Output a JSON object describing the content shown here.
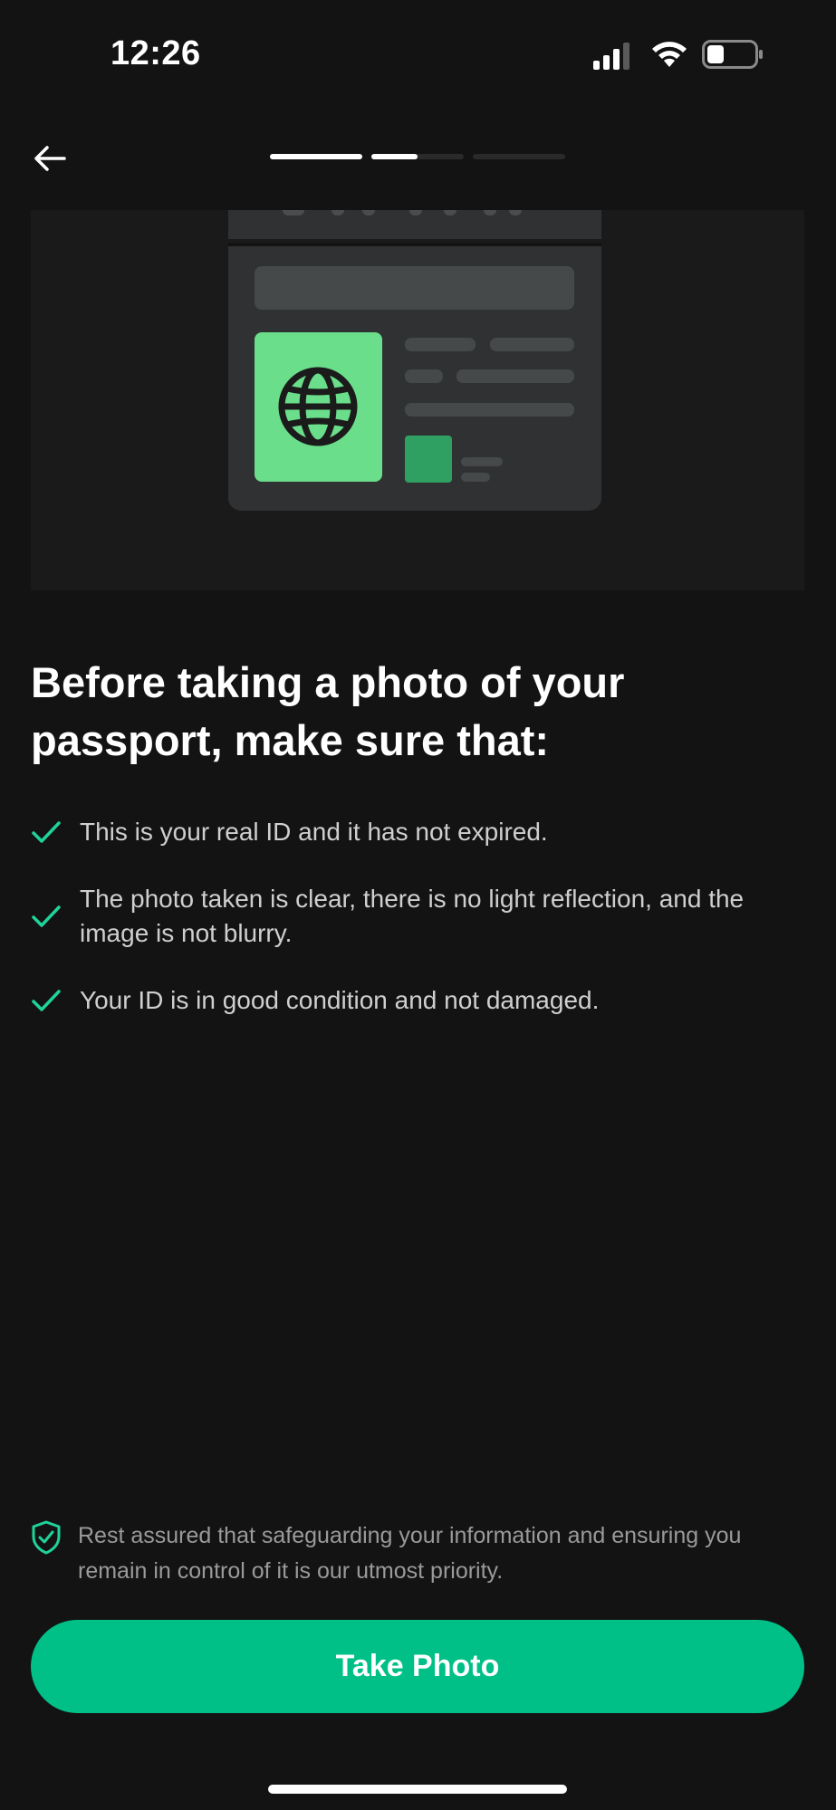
{
  "status_bar": {
    "time": "12:26",
    "icons": [
      "signal-icon",
      "wifi-icon",
      "battery-icon"
    ]
  },
  "nav": {
    "back_icon": "arrow-left-icon",
    "progress": {
      "segments": 3,
      "segment_fill": [
        1,
        0.5,
        0
      ]
    }
  },
  "hero": {
    "illustration": "passport-icon",
    "accent_color": "#6ade8a"
  },
  "main": {
    "title": "Before taking a photo of your passport, make sure that:",
    "checklist": [
      "This is your real ID and it has not expired.",
      "The photo taken is clear, there is no light reflection, and the image is not blurry.",
      "Your ID is in good condition and not damaged."
    ]
  },
  "privacy": {
    "icon": "shield-check-icon",
    "text": "Rest assured that safeguarding your information and ensuring you remain in control of it is our utmost priority."
  },
  "action": {
    "take_photo_label": "Take Photo"
  },
  "colors": {
    "background": "#131313",
    "accent": "#00c087",
    "check": "#1fd39a"
  }
}
